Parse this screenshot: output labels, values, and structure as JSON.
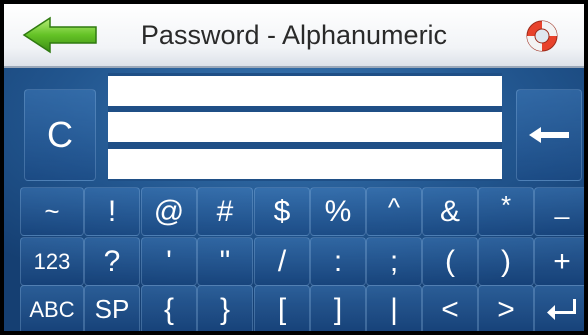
{
  "header": {
    "title": "Password - Alphanumeric",
    "back_icon": "green-left-arrow-icon",
    "help_icon": "lifebuoy-icon"
  },
  "clear_key": {
    "label": "C"
  },
  "backspace_key": {
    "icon": "backspace-arrow-icon"
  },
  "password_field": {
    "value": ""
  },
  "keyboard": {
    "rows": [
      [
        "~",
        "!",
        "@",
        "#",
        "$",
        "%",
        "^",
        "&",
        "*",
        "_"
      ],
      [
        "123",
        "?",
        "'",
        "\"",
        "/",
        ":",
        ";",
        "(",
        ")",
        "+"
      ],
      [
        "ABC",
        "SP",
        "{",
        "}",
        "[",
        "]",
        "|",
        "<",
        ">",
        ""
      ]
    ],
    "enter_icon": "enter-key-icon"
  },
  "colors": {
    "background": "#22568f",
    "title_bar": "#ffffff",
    "key_text": "#ffffff",
    "arrow": "#5fbf2a",
    "lifebuoy": "#e8432c"
  }
}
